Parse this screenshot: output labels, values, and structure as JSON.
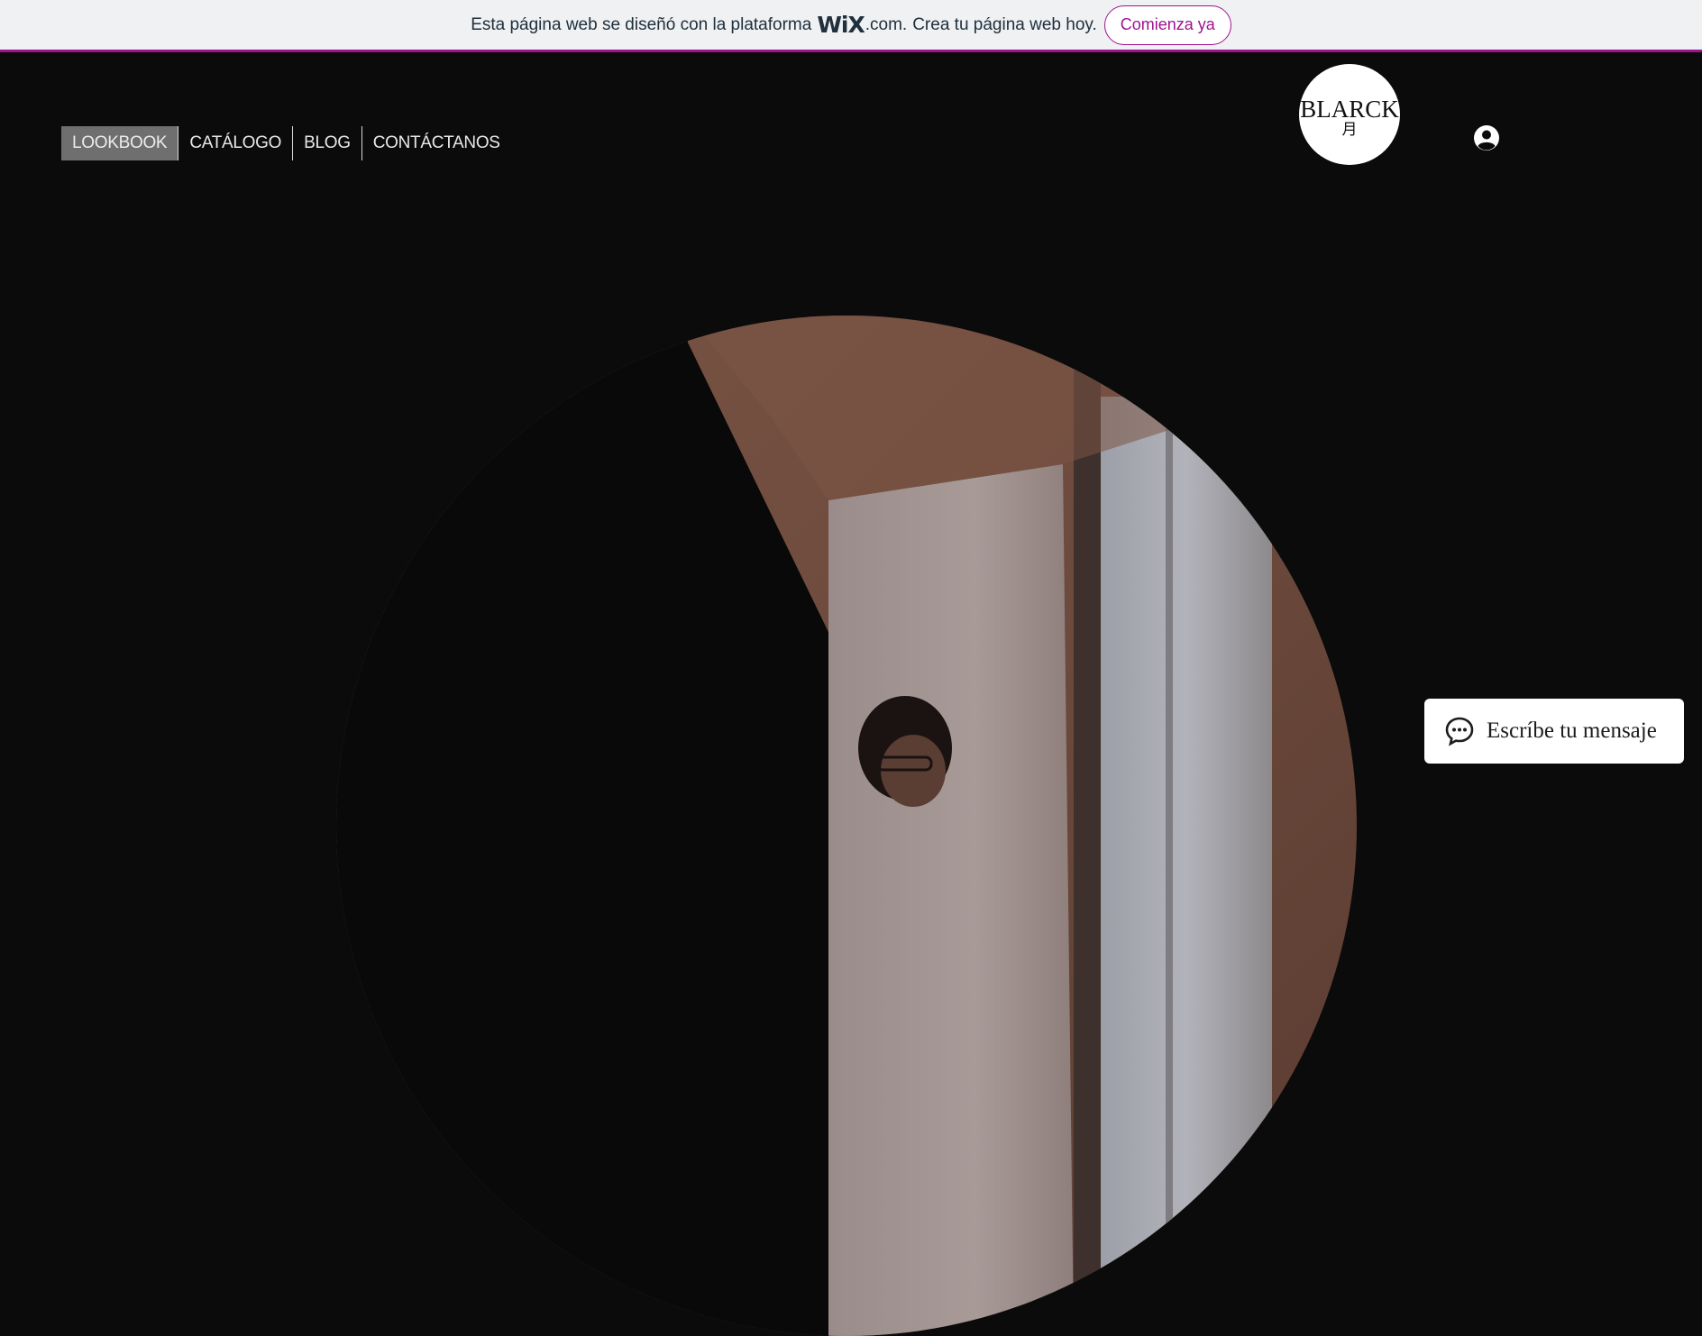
{
  "wix_banner": {
    "text_before": "Esta página web se diseñó con la plataforma",
    "wix_logo": "WiX",
    "domain": ".com.",
    "text_after": "Crea tu página web hoy.",
    "cta_label": "Comienza ya",
    "accent_color": "#a0138e"
  },
  "nav": {
    "items": [
      {
        "label": "LOOKBOOK",
        "active": true
      },
      {
        "label": "CATÁLOGO",
        "active": false
      },
      {
        "label": "BLOG",
        "active": false
      },
      {
        "label": "CONTÁCTANOS",
        "active": false
      }
    ]
  },
  "brand": {
    "name": "BLARCK",
    "glyph": "月"
  },
  "header": {
    "account_icon": "account-icon"
  },
  "chat": {
    "label": "Escríbe tu mensaje",
    "icon": "chat-bubble-icon"
  },
  "colors": {
    "page_background": "#0b0b0c",
    "banner_background": "#eff1f3",
    "nav_active_background": "#6f6f6f"
  }
}
